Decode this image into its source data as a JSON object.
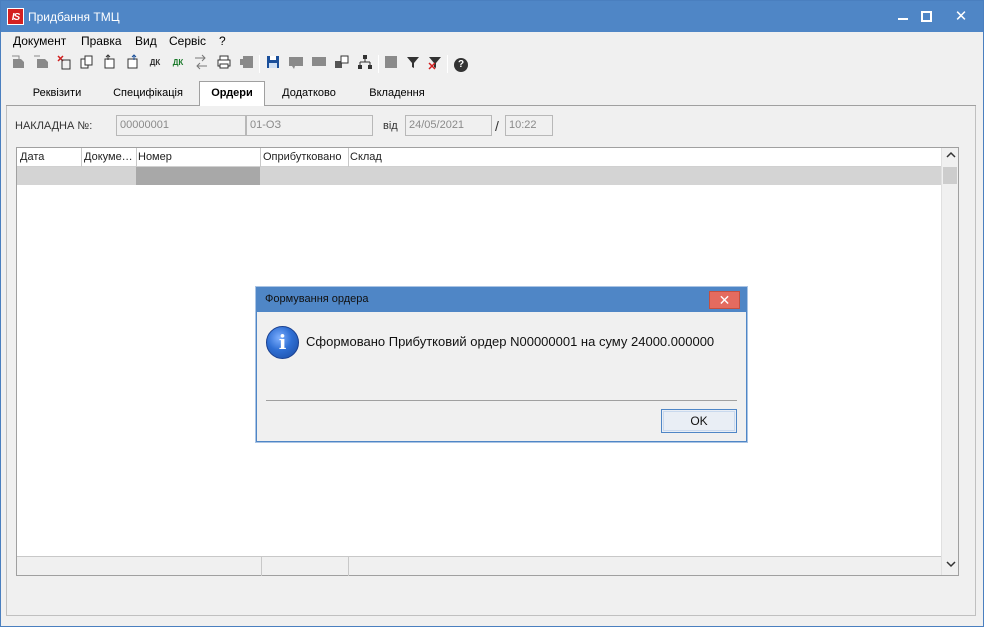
{
  "window": {
    "title": "Придбання ТМЦ",
    "logo_text": "IS",
    "close_glyph": "✕"
  },
  "menu": [
    {
      "label": "Документ"
    },
    {
      "label": "Правка"
    },
    {
      "label": "Вид"
    },
    {
      "label": "Сервіс"
    },
    {
      "label": "?"
    }
  ],
  "toolbar": {
    "glyph_dk": "ДК",
    "help_glyph": "?"
  },
  "tabs": [
    {
      "label": "Реквізити"
    },
    {
      "label": "Специфікація"
    },
    {
      "label": "Ордери"
    },
    {
      "label": "Додатково"
    },
    {
      "label": "Вкладення"
    }
  ],
  "document": {
    "invoice_label": "НАКЛАДНА №:",
    "invoice_number": "00000001",
    "invoice_code": "01-ОЗ",
    "date_label": "від",
    "date": "24/05/2021",
    "slash": "/",
    "time": "10:22"
  },
  "grid": {
    "columns": [
      {
        "label": "Дата"
      },
      {
        "label": "Докуме…"
      },
      {
        "label": "Номер"
      },
      {
        "label": "Оприбутковано"
      },
      {
        "label": "Склад"
      }
    ]
  },
  "dialog": {
    "title": "Формування ордера",
    "message": "Сформовано Прибутковий ордер N00000001 на суму 24000.000000",
    "ok_label": "OK",
    "close_glyph": "✕"
  },
  "colors": {
    "titlebar": "#4f86c6",
    "dialog_close": "#e46b5f",
    "selected_row": "#d4d4d4",
    "selected_cell": "#a8a8a8"
  }
}
